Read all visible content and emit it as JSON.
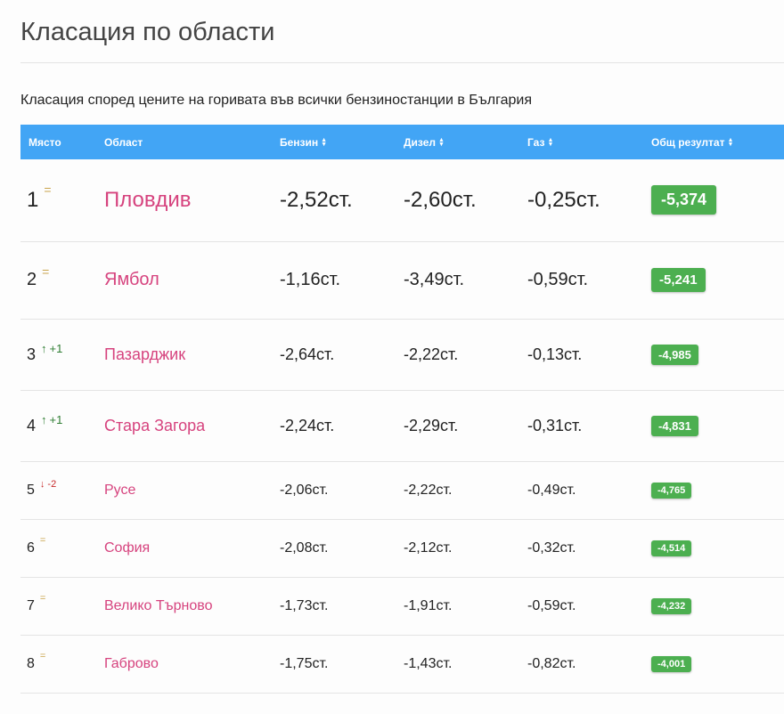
{
  "page": {
    "title": "Класация по области",
    "subtitle": "Класация според цените на горивата във всички бензиностанции в България"
  },
  "table": {
    "headers": {
      "place": "Място",
      "region": "Област",
      "petrol": "Бензин",
      "diesel": "Дизел",
      "gas": "Газ",
      "total": "Общ резултат"
    },
    "sort_icon": "sort-arrows-icon",
    "rows": [
      {
        "place": "1",
        "change": "=",
        "change_type": "same",
        "region": "Пловдив",
        "petrol": "-2,52ст.",
        "diesel": "-2,60ст.",
        "gas": "-0,25ст.",
        "total": "-5,374"
      },
      {
        "place": "2",
        "change": "=",
        "change_type": "same",
        "region": "Ямбол",
        "petrol": "-1,16ст.",
        "diesel": "-3,49ст.",
        "gas": "-0,59ст.",
        "total": "-5,241"
      },
      {
        "place": "3",
        "change": "+1",
        "change_type": "up",
        "region": "Пазарджик",
        "petrol": "-2,64ст.",
        "diesel": "-2,22ст.",
        "gas": "-0,13ст.",
        "total": "-4,985"
      },
      {
        "place": "4",
        "change": "+1",
        "change_type": "up",
        "region": "Стара Загора",
        "petrol": "-2,24ст.",
        "diesel": "-2,29ст.",
        "gas": "-0,31ст.",
        "total": "-4,831"
      },
      {
        "place": "5",
        "change": "-2",
        "change_type": "down",
        "region": "Русе",
        "petrol": "-2,06ст.",
        "diesel": "-2,22ст.",
        "gas": "-0,49ст.",
        "total": "-4,765"
      },
      {
        "place": "6",
        "change": "=",
        "change_type": "same",
        "region": "София",
        "petrol": "-2,08ст.",
        "diesel": "-2,12ст.",
        "gas": "-0,32ст.",
        "total": "-4,514"
      },
      {
        "place": "7",
        "change": "=",
        "change_type": "same",
        "region": "Велико Търново",
        "petrol": "-1,73ст.",
        "diesel": "-1,91ст.",
        "gas": "-0,59ст.",
        "total": "-4,232"
      },
      {
        "place": "8",
        "change": "=",
        "change_type": "same",
        "region": "Габрово",
        "petrol": "-1,75ст.",
        "diesel": "-1,43ст.",
        "gas": "-0,82ст.",
        "total": "-4,001"
      }
    ]
  },
  "colors": {
    "header_bg": "#42a5f5",
    "region_link": "#d6437e",
    "score_badge": "#4caf50",
    "rank_up": "#2e7d32",
    "rank_down": "#c62828",
    "rank_same": "#c9a34a"
  }
}
